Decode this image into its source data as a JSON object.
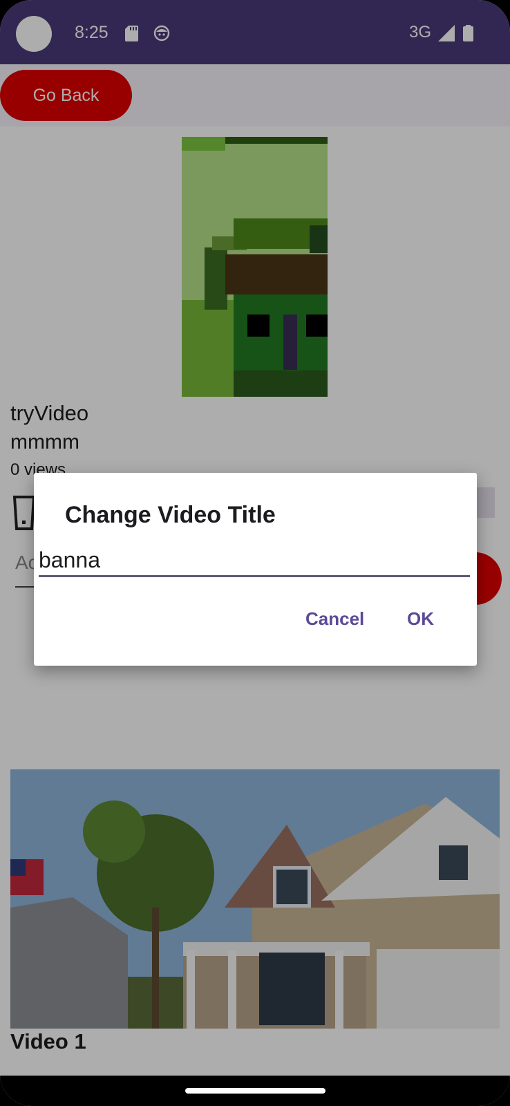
{
  "status_bar": {
    "time": "8:25",
    "network": "3G",
    "icons": [
      "sd-card-icon",
      "face-icon",
      "signal-icon",
      "battery-icon"
    ]
  },
  "top_bar": {
    "back_button_label": "Go Back"
  },
  "video": {
    "title": "tryVideo",
    "description": "mmmm",
    "views": "0 views",
    "comment_placeholder": "Ac"
  },
  "list": {
    "first_item_title": "Video 1"
  },
  "dialog": {
    "title": "Change Video Title",
    "input_value": "banna",
    "cancel_label": "Cancel",
    "ok_label": "OK"
  },
  "colors": {
    "status_bar": "#4a3a7a",
    "accent_red": "#e00000",
    "dialog_button": "#5b4a96"
  }
}
